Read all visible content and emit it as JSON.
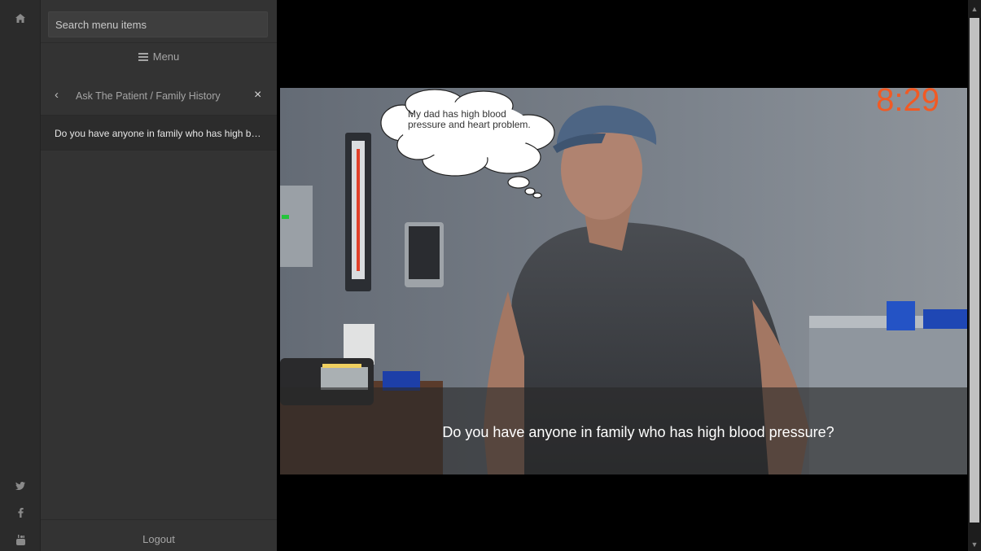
{
  "rail": {
    "icons": [
      "home-icon",
      "twitter-icon",
      "facebook-icon",
      "youtube-icon"
    ]
  },
  "sidebar": {
    "search_placeholder": "Search menu items",
    "menu_label": "Menu",
    "breadcrumb": "Ask The Patient / Family History",
    "items": [
      {
        "label": "Do you have anyone in family who has high blood pressure?"
      }
    ],
    "logout_label": "Logout"
  },
  "player": {
    "timer": "8:29",
    "speech_bubble": "My dad has high blood pressure and heart problem.",
    "subtitle": "Do you have anyone in family who has high blood pressure?"
  },
  "colors": {
    "timer": "#f15a24",
    "sidebar_bg": "#333333",
    "rail_bg": "#2b2b2b"
  }
}
